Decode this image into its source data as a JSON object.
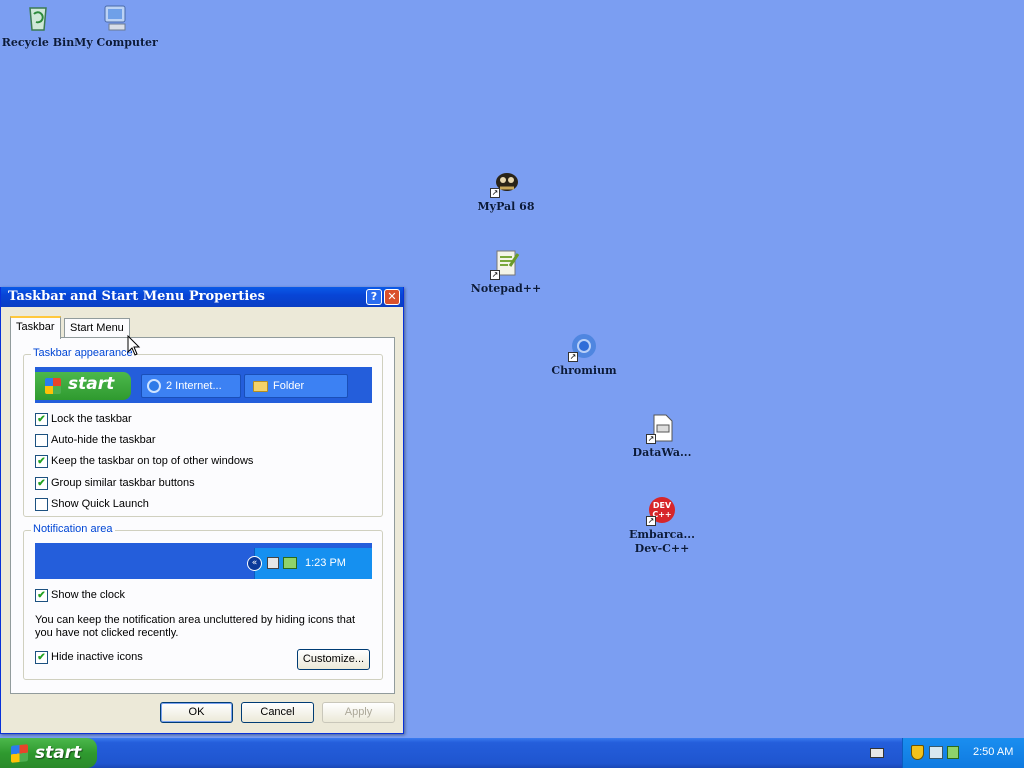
{
  "desktop": {
    "icons": [
      {
        "label": "Recycle Bin"
      },
      {
        "label": "My Computer"
      },
      {
        "label": "MyPal 68"
      },
      {
        "label": "Notepad++"
      },
      {
        "label": "Chromium"
      },
      {
        "label": "DataWa..."
      },
      {
        "label": "Embarca... Dev-C++"
      }
    ],
    "devcpp_logo_text": "DEV C++",
    "shortcut_arrow": "↗"
  },
  "dialog": {
    "title": "Taskbar and Start Menu Properties",
    "help_glyph": "?",
    "close_glyph": "✕",
    "tabs": [
      "Taskbar",
      "Start Menu"
    ],
    "appearance": {
      "legend": "Taskbar appearance",
      "preview_start": "start",
      "preview_btn1": "2 Internet...",
      "preview_btn2": "Folder",
      "options": [
        {
          "label": "Lock the taskbar",
          "checked": "✔"
        },
        {
          "label": "Auto-hide the taskbar",
          "checked": ""
        },
        {
          "label": "Keep the taskbar on top of other windows",
          "checked": "✔"
        },
        {
          "label": "Group similar taskbar buttons",
          "checked": "✔"
        },
        {
          "label": "Show Quick Launch",
          "checked": ""
        }
      ]
    },
    "notification": {
      "legend": "Notification area",
      "preview_time": "1:23 PM",
      "show_clock": {
        "label": "Show the clock",
        "checked": "✔"
      },
      "note": "You can keep the notification area uncluttered by hiding icons that you have not clicked recently.",
      "hide_inactive": {
        "label": "Hide inactive icons",
        "checked": "✔"
      },
      "customize": "Customize..."
    },
    "buttons": {
      "ok": "OK",
      "cancel": "Cancel",
      "apply": "Apply"
    }
  },
  "taskbar": {
    "start": "start",
    "clock": "2:50 AM"
  },
  "colors": {
    "desktop": "#7b9ef2",
    "title_blue": "#0845d6",
    "legend_blue": "#0046d5",
    "start_green": "#2f9a2f"
  }
}
